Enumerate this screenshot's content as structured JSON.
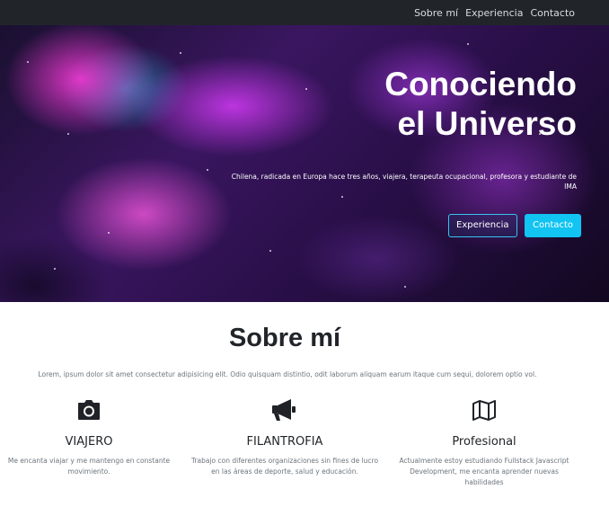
{
  "nav": {
    "items": [
      "Sobre mí",
      "Experiencia",
      "Contacto"
    ]
  },
  "hero": {
    "title_line1": "Conociendo",
    "title_line2": "el Universo",
    "subtitle": "Chilena, radicada en Europa hace tres años, viajera, terapeuta ocupacional, profesora y estudiante de IMA",
    "btn_experiencia": "Experiencia",
    "btn_contacto": "Contacto"
  },
  "about": {
    "title": "Sobre mí",
    "text": "Lorem, ipsum dolor sit amet consectetur adipisicing elit. Odio quisquam distintio, odit laborum aliquam earum itaque cum sequi, dolorem optio vol."
  },
  "features": [
    {
      "icon": "camera-icon",
      "title": "VIAJERO",
      "desc": "Me encanta viajar y me mantengo en constante movimiento."
    },
    {
      "icon": "megaphone-icon",
      "title": "FILANTROFIA",
      "desc": "Trabajo con diferentes organizaciones sin fines de lucro en las áreas de deporte, salud y educación."
    },
    {
      "icon": "map-icon",
      "title": "Profesional",
      "desc": "Actualmente estoy estudiando Fullstack Javascript Development, me encanta aprender nuevas habilidades"
    }
  ],
  "colors": {
    "navbar": "#212529",
    "accent": "#11c4f2",
    "text_muted": "#6c757d"
  }
}
